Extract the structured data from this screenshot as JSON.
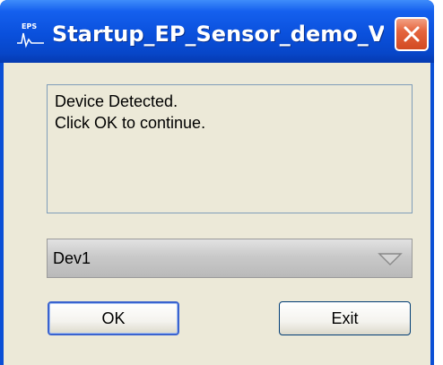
{
  "window": {
    "title": "Startup_EP_Sensor_demo_V...",
    "app_icon_text": "EPS",
    "colors": {
      "titlebar": "#0a50dc",
      "close_button": "#e5653e",
      "client_background": "#ece9d8"
    }
  },
  "message": {
    "lines": [
      "Device Detected.",
      "Click OK to continue."
    ]
  },
  "device_select": {
    "selected": "Dev1"
  },
  "buttons": {
    "ok_label": "OK",
    "exit_label": "Exit"
  },
  "icons": {
    "app": "eps-waveform-icon",
    "close": "close-icon",
    "dropdown": "chevron-down-icon"
  }
}
